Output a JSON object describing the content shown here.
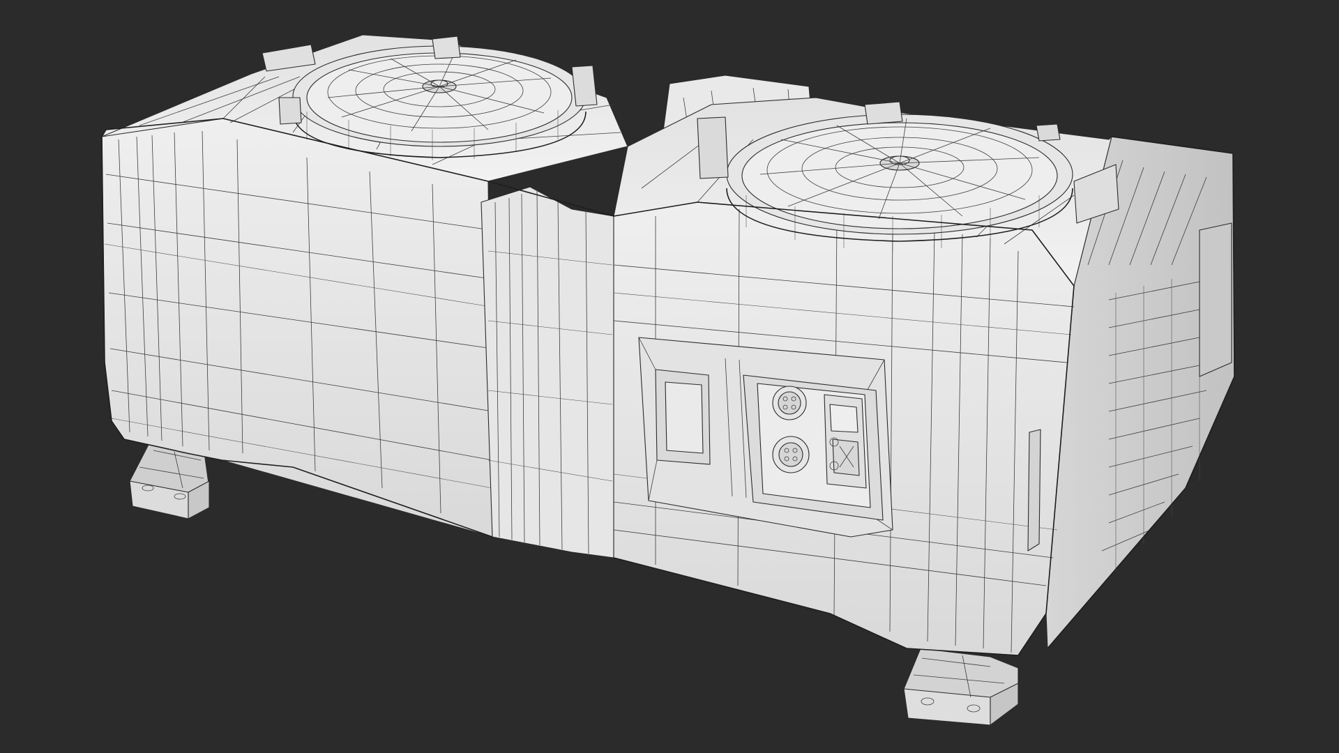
{
  "scene": {
    "background_color": "#2b2b2b",
    "model_fill_light": "#f0f0f0",
    "model_fill_mid": "#dedede",
    "model_fill_shadow": "#c4c4c4",
    "wire_color": "#3a3a3a",
    "render_mode": "wireframe-on-shaded"
  }
}
